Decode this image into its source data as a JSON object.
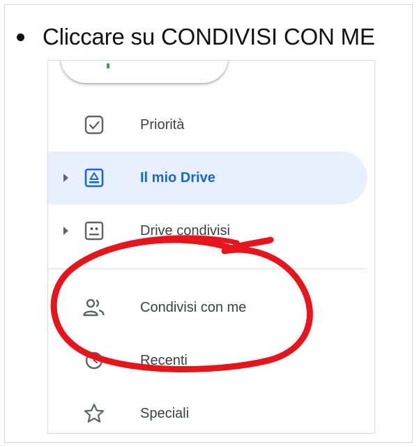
{
  "instruction": {
    "text": "Cliccare su CONDIVISI CON ME"
  },
  "sidebar": {
    "items": [
      {
        "label": "Priorità",
        "icon": "priority-checkbox-icon",
        "active": false,
        "expandable": false
      },
      {
        "label": "Il mio Drive",
        "icon": "my-drive-icon",
        "active": true,
        "expandable": true
      },
      {
        "label": "Drive condivisi",
        "icon": "shared-drives-icon",
        "active": false,
        "expandable": true
      },
      {
        "label": "Condivisi con me",
        "icon": "people-icon",
        "active": false,
        "expandable": false
      },
      {
        "label": "Recenti",
        "icon": "clock-icon",
        "active": false,
        "expandable": false
      },
      {
        "label": "Speciali",
        "icon": "star-icon",
        "active": false,
        "expandable": false
      }
    ]
  },
  "colors": {
    "active_background": "#e8f0fe",
    "active_text": "#1967d2",
    "text": "#3c4043",
    "icon": "#5f6368",
    "annotation": "#e8141c"
  }
}
